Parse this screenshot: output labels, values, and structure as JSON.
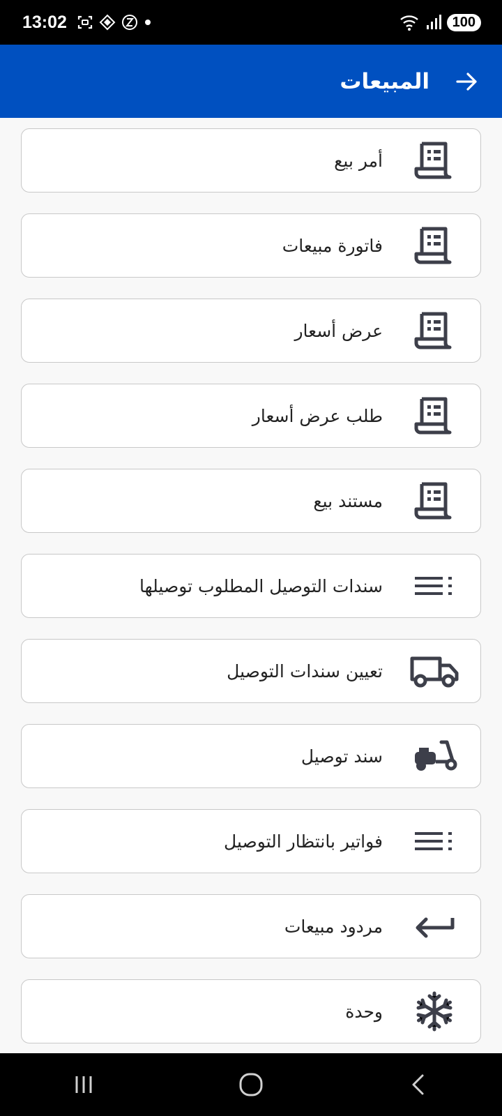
{
  "status": {
    "time": "13:02",
    "battery": "100",
    "network": "5"
  },
  "header": {
    "title": "المبيعات"
  },
  "menu": {
    "items": [
      {
        "label": "أمر بيع",
        "icon": "receipt-icon"
      },
      {
        "label": "فاتورة مبيعات",
        "icon": "receipt-icon"
      },
      {
        "label": "عرض أسعار",
        "icon": "receipt-icon"
      },
      {
        "label": "طلب عرض أسعار",
        "icon": "receipt-icon"
      },
      {
        "label": "مستند بيع",
        "icon": "receipt-icon"
      },
      {
        "label": "سندات التوصيل المطلوب توصيلها",
        "icon": "list-icon"
      },
      {
        "label": "تعيين سندات التوصيل",
        "icon": "truck-icon"
      },
      {
        "label": "سند توصيل",
        "icon": "scooter-icon"
      },
      {
        "label": "فواتير بانتظار التوصيل",
        "icon": "list-icon"
      },
      {
        "label": "مردود مبيعات",
        "icon": "return-icon"
      },
      {
        "label": "وحدة",
        "icon": "snowflake-icon"
      }
    ]
  },
  "colors": {
    "app_bar": "#0050c0",
    "icon": "#3d3f4a"
  }
}
